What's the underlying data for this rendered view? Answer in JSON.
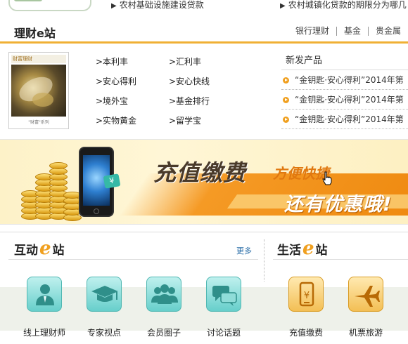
{
  "top_news": [
    "农村基础设施建设贷款",
    "农村城镇化贷款的期限分为哪几"
  ],
  "finance": {
    "title": "理财e站",
    "tabs": [
      "银行理财",
      "基金",
      "贵金属"
    ],
    "magazine": {
      "masthead": "财富理财",
      "footer": "\"财富\"系列"
    },
    "products": [
      ">本利丰",
      ">汇利丰",
      ">安心得利",
      ">安心快线",
      ">境外宝",
      ">基金排行",
      ">实物黄金",
      ">留学宝"
    ],
    "new_products": {
      "title": "新发产品",
      "items": [
        "“金钥匙·安心得利”2014年第",
        "“金钥匙·安心得利”2014年第",
        "“金钥匙·安心得利”2014年第"
      ]
    }
  },
  "banner": {
    "main": "充值缴费",
    "sub": "方便快捷",
    "line2": "还有优惠哦!",
    "badge": "¥"
  },
  "interact": {
    "title_a": "互动",
    "title_e": "e",
    "title_b": "站",
    "more": "更多",
    "items": [
      {
        "label": "线上理财师",
        "icon": "advisor-icon"
      },
      {
        "label": "专家视点",
        "icon": "graduation-cap-icon"
      },
      {
        "label": "会员圈子",
        "icon": "group-icon"
      },
      {
        "label": "讨论话题",
        "icon": "chat-bubbles-icon"
      }
    ]
  },
  "life": {
    "title_a": "生活",
    "title_e": "e",
    "title_b": "站",
    "items": [
      {
        "label": "充值缴费",
        "icon": "phone-recharge-icon"
      },
      {
        "label": "机票旅游",
        "icon": "airplane-icon"
      }
    ]
  },
  "colors": {
    "accent": "#f0b035",
    "teal_tile": "#67cfcb",
    "orange_tile": "#f3bf55",
    "link_blue": "#2a6ea8"
  }
}
